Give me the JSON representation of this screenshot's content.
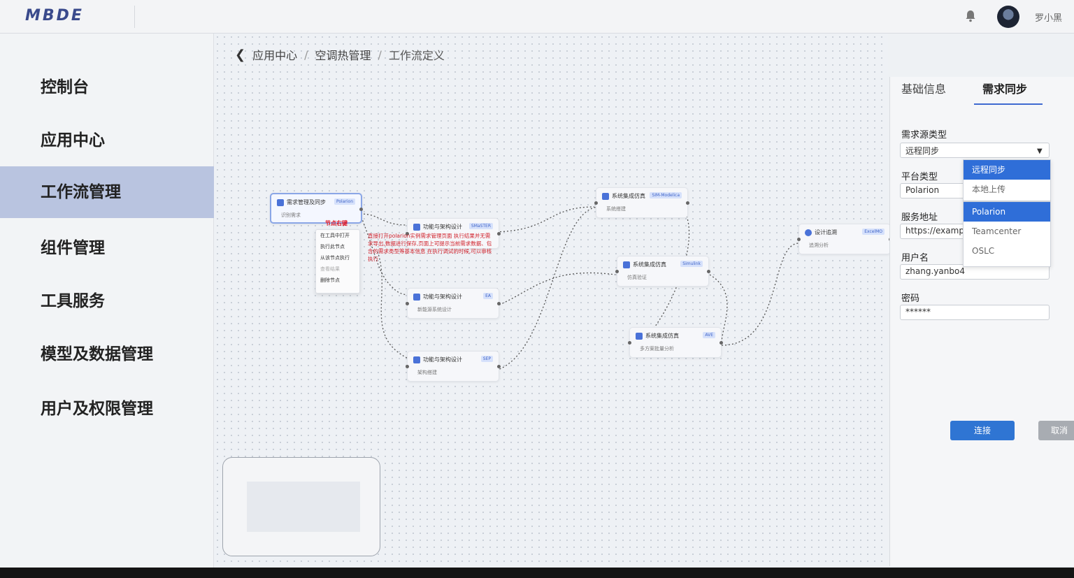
{
  "header": {
    "logo": "MBDE",
    "username": "罗小黑",
    "bell_icon": "bell-icon"
  },
  "sidebar": {
    "items": [
      {
        "label": "控制台"
      },
      {
        "label": "应用中心"
      },
      {
        "label": "工作流管理",
        "active": true
      },
      {
        "label": "组件管理"
      },
      {
        "label": "工具服务"
      },
      {
        "label": "模型及数据管理"
      },
      {
        "label": "用户及权限管理"
      }
    ]
  },
  "breadcrumb": {
    "items": [
      "应用中心",
      "空调热管理",
      "工作流定义"
    ],
    "separator": "/"
  },
  "workflow": {
    "nodes": [
      {
        "title": "需求管理及同步",
        "tag": "Polarion",
        "sub": "识别需求"
      },
      {
        "title": "功能与架构设计",
        "tag": "SMaSTER",
        "sub": ""
      },
      {
        "title": "功能与架构设计",
        "tag": "EA",
        "sub": "新能源系统设计"
      },
      {
        "title": "功能与架构设计",
        "tag": "SEP",
        "sub": "架构搭建"
      },
      {
        "title": "系统集成仿真",
        "tag": "SIM-Modelica",
        "sub": "系统搭建"
      },
      {
        "title": "系统集成仿真",
        "tag": "Simulink",
        "sub": "仿真验证"
      },
      {
        "title": "系统集成仿真",
        "tag": "AVE",
        "sub": "多方案批量分析"
      },
      {
        "title": "设计追溯",
        "tag": "ExcelMO",
        "sub": "追溯分析"
      }
    ],
    "context_menu": {
      "title": "节点右键",
      "items": [
        "在工具中打开",
        "执行此节点",
        "从该节点执行",
        "查看结果",
        "删除节点"
      ]
    },
    "annotation": "直接打开polarion实例需求管理页面 执行结果并无需求导出,数据进行保存,页面上可提示当前需求数据、包含的需求类型等基本信息 在执行调试的时候,可以审核执行"
  },
  "panel": {
    "tabs": [
      "基础信息",
      "需求同步"
    ],
    "active_tab": "需求同步",
    "fields": {
      "source_type_label": "需求源类型",
      "source_type_value": "远程同步",
      "platform_label": "平台类型",
      "platform_value": "Polarion",
      "address_label": "服务地址",
      "address_value": "https://examp",
      "username_label": "用户名",
      "username_value": "zhang.yanbo4",
      "password_label": "密码",
      "password_value": "******"
    },
    "source_dropdown": [
      "远程同步",
      "本地上传"
    ],
    "platform_dropdown": [
      "Polarion",
      "Teamcenter",
      "OSLC"
    ],
    "connect_button": "连接",
    "cancel_button": "取消"
  },
  "colors": {
    "accent": "#2f75d3",
    "sidebar_active": "#b9c4e0",
    "annotation_red": "#d0202a"
  }
}
